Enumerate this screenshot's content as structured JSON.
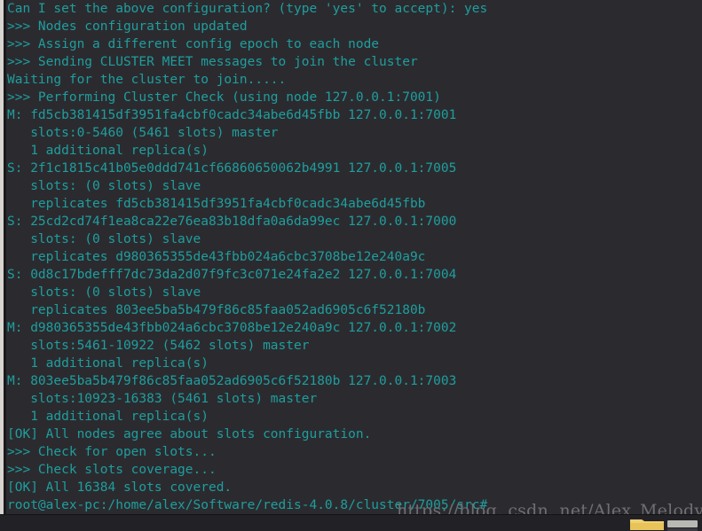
{
  "window": {
    "title": "root@alex-pc: /home/alex/Software/redis-4.0.8/cluster/7005/src",
    "background_color": "#2b2b2f",
    "text_color": "#1f9e9e"
  },
  "terminal": {
    "lines": [
      "Can I set the above configuration? (type 'yes' to accept): yes",
      ">>> Nodes configuration updated",
      ">>> Assign a different config epoch to each node",
      ">>> Sending CLUSTER MEET messages to join the cluster",
      "Waiting for the cluster to join.....",
      ">>> Performing Cluster Check (using node 127.0.0.1:7001)",
      "M: fd5cb381415df3951fa4cbf0cadc34abe6d45fbb 127.0.0.1:7001",
      "   slots:0-5460 (5461 slots) master",
      "   1 additional replica(s)",
      "S: 2f1c1815c41b05e0ddd741cf66860650062b4991 127.0.0.1:7005",
      "   slots: (0 slots) slave",
      "   replicates fd5cb381415df3951fa4cbf0cadc34abe6d45fbb",
      "S: 25cd2cd74f1ea8ca22e76ea83b18dfa0a6da99ec 127.0.0.1:7000",
      "   slots: (0 slots) slave",
      "   replicates d980365355de43fbb024a6cbc3708be12e240a9c",
      "S: 0d8c17bdefff7dc73da2d07f9fc3c071e24fa2e2 127.0.0.1:7004",
      "   slots: (0 slots) slave",
      "   replicates 803ee5ba5b479f86c85faa052ad6905c6f52180b",
      "M: d980365355de43fbb024a6cbc3708be12e240a9c 127.0.0.1:7002",
      "   slots:5461-10922 (5462 slots) master",
      "   1 additional replica(s)",
      "M: 803ee5ba5b479f86c85faa052ad6905c6f52180b 127.0.0.1:7003",
      "   slots:10923-16383 (5461 slots) master",
      "   1 additional replica(s)",
      "[OK] All nodes agree about slots configuration.",
      ">>> Check for open slots...",
      ">>> Check slots coverage...",
      "[OK] All 16384 slots covered.",
      "root@alex-pc:/home/alex/Software/redis-4.0.8/cluster/7005/src#"
    ]
  },
  "watermark": {
    "text": "https://blog. csdn. net/Alex_Melody",
    "color": "#6e6e74"
  },
  "taskbar": {
    "folder_icon_label": "folder-icon",
    "folder_color": "#e8c35a"
  }
}
